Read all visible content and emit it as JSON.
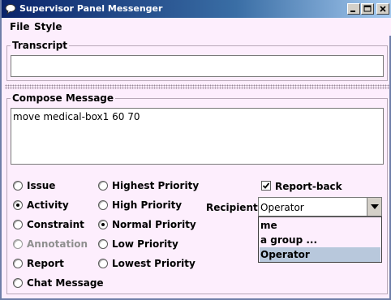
{
  "window": {
    "title": "Supervisor Panel Messenger"
  },
  "menu": {
    "file": "File",
    "style": "Style"
  },
  "transcript": {
    "legend": "Transcript",
    "text": ""
  },
  "compose": {
    "legend": "Compose Message",
    "text": "move medical-box1 60 70"
  },
  "message_types": [
    {
      "label": "Issue",
      "selected": false,
      "enabled": true
    },
    {
      "label": "Activity",
      "selected": true,
      "enabled": true
    },
    {
      "label": "Constraint",
      "selected": false,
      "enabled": true
    },
    {
      "label": "Annotation",
      "selected": false,
      "enabled": false
    },
    {
      "label": "Report",
      "selected": false,
      "enabled": true
    },
    {
      "label": "Chat Message",
      "selected": false,
      "enabled": true
    }
  ],
  "priorities": [
    {
      "label": "Highest Priority",
      "selected": false
    },
    {
      "label": "High Priority",
      "selected": false
    },
    {
      "label": "Normal Priority",
      "selected": true
    },
    {
      "label": "Low Priority",
      "selected": false
    },
    {
      "label": "Lowest Priority",
      "selected": false
    }
  ],
  "report_back": {
    "label": "Report-back",
    "checked": true
  },
  "recipient": {
    "label": "Recipient =",
    "value": "Operator",
    "options": [
      "me",
      "a group ...",
      "Operator"
    ],
    "highlighted_option": "Operator"
  }
}
